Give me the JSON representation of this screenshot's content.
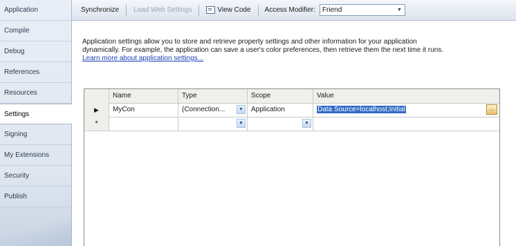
{
  "sidebar": {
    "items": [
      {
        "label": "Application"
      },
      {
        "label": "Compile"
      },
      {
        "label": "Debug"
      },
      {
        "label": "References"
      },
      {
        "label": "Resources"
      },
      {
        "label": "Settings"
      },
      {
        "label": "Signing"
      },
      {
        "label": "My Extensions"
      },
      {
        "label": "Security"
      },
      {
        "label": "Publish"
      }
    ],
    "active": "Settings"
  },
  "toolbar": {
    "synchronize": "Synchronize",
    "load_web_settings": "Load Web Settings",
    "view_code": "View Code",
    "access_modifier_label": "Access Modifier:",
    "access_modifier_value": "Friend"
  },
  "description": {
    "line1": "Application settings allow you to store and retrieve property settings and other information for your application",
    "line2": "dynamically. For example, the application can save a user's color preferences, then retrieve them the next time it runs.",
    "link": "Learn more about application settings..."
  },
  "grid": {
    "columns": [
      "Name",
      "Type",
      "Scope",
      "Value"
    ],
    "rows": [
      {
        "marker": "▶",
        "name": "MyCon",
        "type": "(Connection...",
        "scope": "Application",
        "value": "Data Source=localhost;Initial"
      },
      {
        "marker": "*",
        "name": "",
        "type": "",
        "scope": "",
        "value": ""
      }
    ]
  }
}
